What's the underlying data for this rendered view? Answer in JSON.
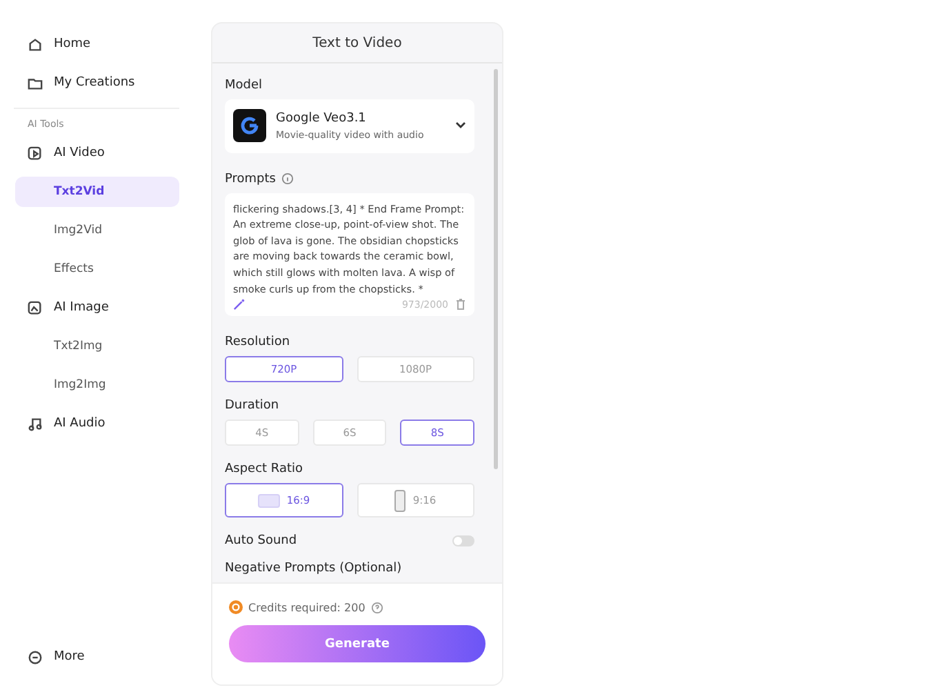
{
  "sidebar": {
    "top_items": [
      {
        "label": "Home"
      },
      {
        "label": "My Creations"
      }
    ],
    "section_label": "AI Tools",
    "groups": [
      {
        "label": "AI Video",
        "children": [
          {
            "label": "Txt2Vid",
            "selected": true
          },
          {
            "label": "Img2Vid",
            "selected": false
          },
          {
            "label": "Effects",
            "selected": false
          }
        ]
      },
      {
        "label": "AI Image",
        "children": [
          {
            "label": "Txt2Img",
            "selected": false
          },
          {
            "label": "Img2Img",
            "selected": false
          }
        ]
      },
      {
        "label": "AI Audio"
      }
    ],
    "bottom_item": {
      "label": "More"
    }
  },
  "panel": {
    "title": "Text to Video",
    "model": {
      "label": "Model",
      "name": "Google Veo3.1",
      "description": "Movie-quality video with audio"
    },
    "prompts": {
      "label": "Prompts",
      "text": "flickering shadows.[3, 4] * End Frame Prompt: An extreme close-up, point-of-view shot. The glob of lava is gone. The obsidian chopsticks are moving back towards the ceramic bowl, which still glows with molten lava. A wisp of smoke curls up from the chopsticks. *",
      "counter": "973/2000"
    },
    "resolution": {
      "label": "Resolution",
      "options": [
        {
          "label": "720P",
          "selected": true
        },
        {
          "label": "1080P",
          "selected": false
        }
      ]
    },
    "duration": {
      "label": "Duration",
      "options": [
        {
          "label": "4S",
          "selected": false
        },
        {
          "label": "6S",
          "selected": false
        },
        {
          "label": "8S",
          "selected": true
        }
      ]
    },
    "aspect_ratio": {
      "label": "Aspect Ratio",
      "options": [
        {
          "label": "16:9",
          "kind": "landscape",
          "selected": true
        },
        {
          "label": "9:16",
          "kind": "portrait",
          "selected": false
        }
      ]
    },
    "auto_sound": {
      "label": "Auto Sound",
      "on": false
    },
    "negative_prompts": {
      "label": "Negative Prompts (Optional)"
    },
    "credits": "Credits required: 200",
    "generate": "Generate"
  }
}
